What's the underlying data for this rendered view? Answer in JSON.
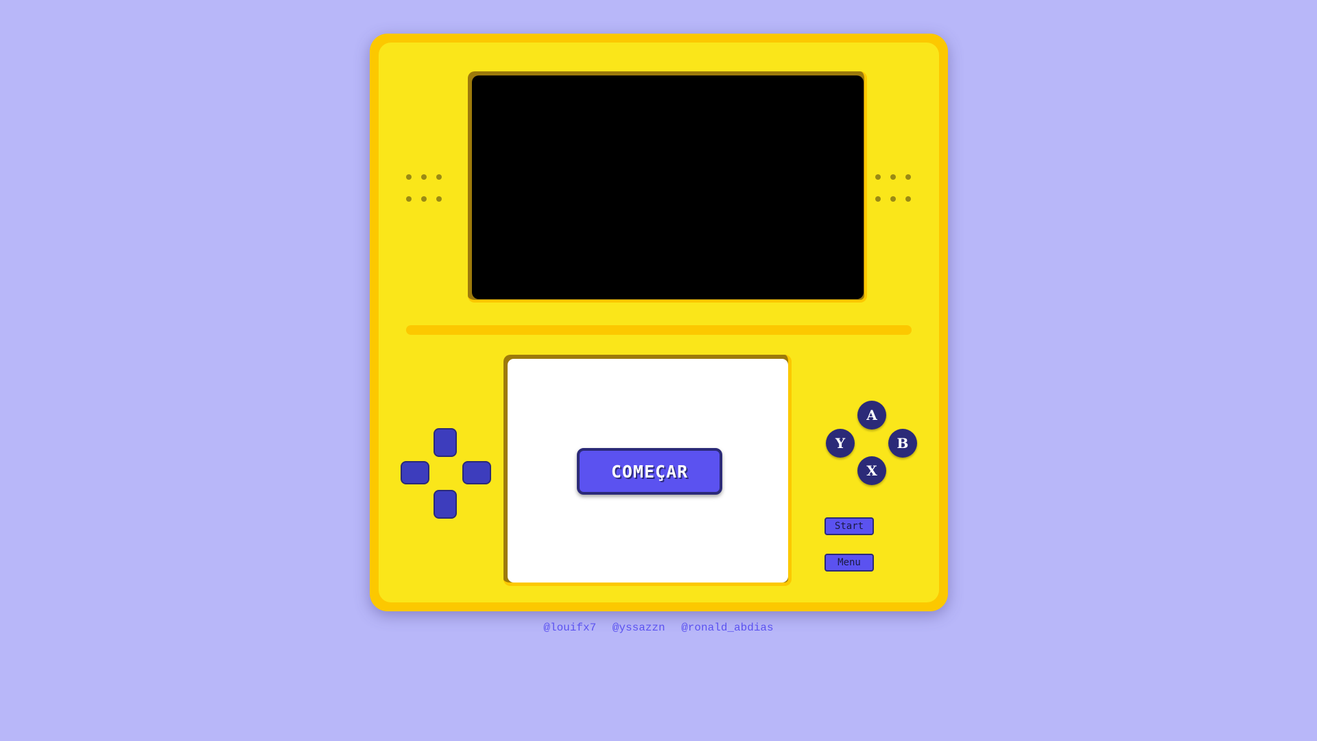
{
  "console": {
    "body_color": "#fcc800",
    "face_color": "#fae61a",
    "accent_color": "#5b52f0",
    "dark_button_color": "#2b2a78"
  },
  "bottom_screen": {
    "start_button_label": "COMEÇAR"
  },
  "face_buttons": {
    "a": "A",
    "b": "B",
    "x": "X",
    "y": "Y"
  },
  "system_buttons": {
    "start": "Start",
    "menu": "Menu"
  },
  "credits": [
    "@louifx7",
    "@yssazzn",
    "@ronald_abdias"
  ]
}
